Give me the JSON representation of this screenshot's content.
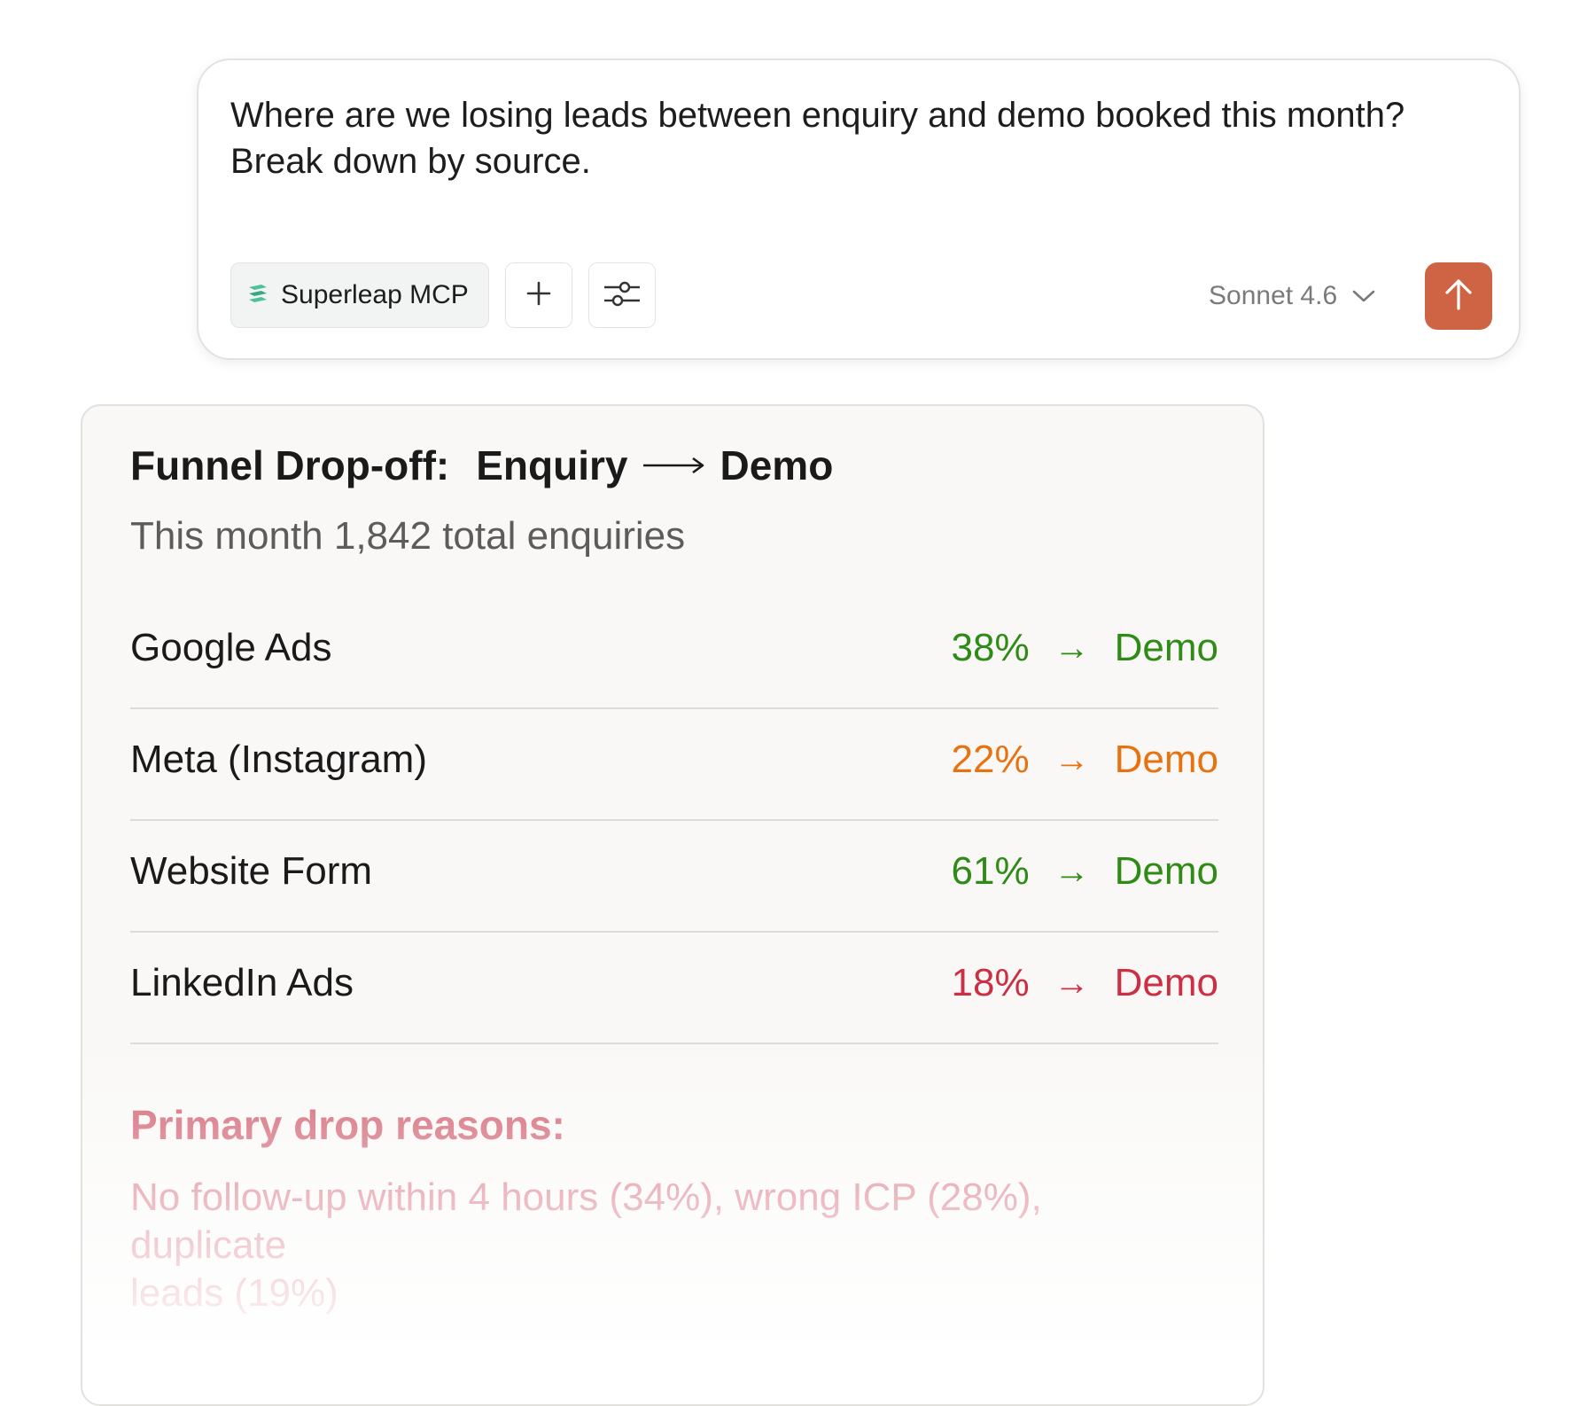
{
  "prompt": {
    "text": "Where are we losing leads between enquiry and demo booked this month? Break down by source.",
    "mcp_chip_label": "Superleap MCP",
    "model_label": "Sonnet 4.6",
    "icons": [
      "superleap-logo-icon",
      "plus-icon",
      "sliders-icon",
      "chevron-down-icon",
      "arrow-up-icon"
    ],
    "colors": {
      "send_button": "#cf6444",
      "logo": "#4cc29a"
    }
  },
  "card": {
    "title_part1": "Funnel Drop-off:",
    "title_part2": "Enquiry",
    "title_part3": "Demo",
    "subtitle": "This month 1,842 total enquiries",
    "rows": [
      {
        "source": "Google Ads",
        "pct": "38%",
        "arrow": "→",
        "target": "Demo",
        "color": "#2e8b16"
      },
      {
        "source": "Meta (Instagram)",
        "pct": "22%",
        "arrow": "→",
        "target": "Demo",
        "color": "#e8720f"
      },
      {
        "source": "Website Form",
        "pct": "61%",
        "arrow": "→",
        "target": "Demo",
        "color": "#2e8b16"
      },
      {
        "source": "LinkedIn Ads",
        "pct": "18%",
        "arrow": "→",
        "target": "Demo",
        "color": "#cc2f44"
      }
    ],
    "reasons_title": "Primary drop reasons:",
    "reasons_line1": "No follow-up within 4 hours (34%), wrong ICP (28%),",
    "reasons_line2": "duplicate",
    "reasons_line3": "leads (19%)"
  }
}
